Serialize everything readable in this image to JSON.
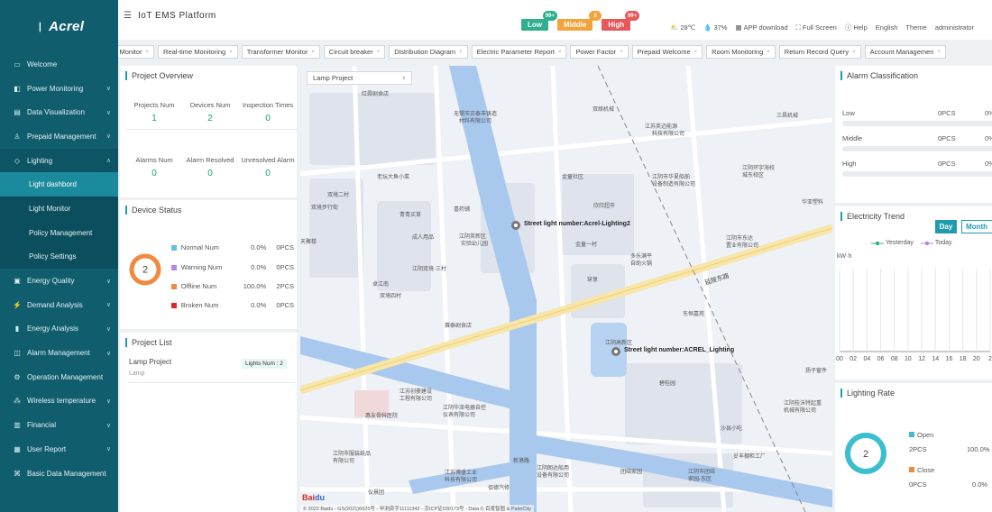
{
  "sidebar": {
    "logo_text": "Acrel",
    "items": [
      {
        "label": "Welcome",
        "icon": "monitor-icon",
        "chev": ""
      },
      {
        "label": "Power Monitoring",
        "icon": "power-icon",
        "chev": "∨"
      },
      {
        "label": "Data Visualization",
        "icon": "chart-screen-icon",
        "chev": "∨"
      },
      {
        "label": "Prepaid Management",
        "icon": "people-icon",
        "chev": "∨"
      },
      {
        "label": "Lighting",
        "icon": "diamond-icon",
        "chev": "∧"
      },
      {
        "label": "Light dashbord",
        "sub": true,
        "active": true
      },
      {
        "label": "Light Monitor",
        "sub": true
      },
      {
        "label": "Policy Management",
        "sub": true
      },
      {
        "label": "Policy Settings",
        "sub": true
      },
      {
        "label": "Energy Quality",
        "icon": "quality-icon",
        "chev": "∨"
      },
      {
        "label": "Demand Analysis",
        "icon": "demand-icon",
        "chev": "∨"
      },
      {
        "label": "Energy Analysis",
        "icon": "bar-chart-icon",
        "chev": "∨"
      },
      {
        "label": "Alarm Management",
        "icon": "alarm-icon",
        "chev": "∨"
      },
      {
        "label": "Operation Management",
        "icon": "operation-icon",
        "chev": ""
      },
      {
        "label": "Wireless temperature",
        "icon": "thermometer-icon",
        "chev": "∨"
      },
      {
        "label": "Financial",
        "icon": "financial-icon",
        "chev": "∨"
      },
      {
        "label": "User Report",
        "icon": "report-icon",
        "chev": "∨"
      },
      {
        "label": "Basic Data Management",
        "icon": "database-icon",
        "chev": ""
      }
    ]
  },
  "header": {
    "title": "IoT EMS Platform",
    "alarms": [
      {
        "label": "Low",
        "count": "99+",
        "color": "#2eb08f",
        "count_color": "#2eb08f"
      },
      {
        "label": "Middle",
        "count": "0",
        "color": "#f2a33a",
        "count_color": "#f2a33a"
      },
      {
        "label": "High",
        "count": "99+",
        "color": "#e8575a",
        "count_color": "#e8575a"
      }
    ],
    "temperature": "28℃",
    "humidity": "37%",
    "app_download": "APP download",
    "full_screen": "Full Screen",
    "help": "Help",
    "language": "English",
    "theme": "Theme",
    "user": "administrator"
  },
  "tabs": [
    "ic Monitor",
    "Real-time Monitoring",
    "Transformer Monitor",
    "Circuit breaker",
    "Distribution Diagram",
    "Electric Parameter Report",
    "Power Factor",
    "Prepaid Welcome",
    "Room Monitoring",
    "Return Record Query",
    "Account Managemen"
  ],
  "project_overview": {
    "title": "Project Overview",
    "stats": [
      {
        "label": "Projects Num",
        "value": "1"
      },
      {
        "label": "Devices Num",
        "value": "2"
      },
      {
        "label": "Inspection Times",
        "value": "0"
      },
      {
        "label": "Alarms Num",
        "value": "0"
      },
      {
        "label": "Alarm Resolved",
        "value": "0"
      },
      {
        "label": "Unresolved Alarm",
        "value": "0"
      }
    ]
  },
  "device_status": {
    "title": "Device Status",
    "center_value": "2",
    "rows": [
      {
        "label": "Normal Num",
        "percent": "0.0%",
        "count": "0PCS",
        "color": "#5fc3df"
      },
      {
        "label": "Warning Num",
        "percent": "0.0%",
        "count": "0PCS",
        "color": "#b785e8"
      },
      {
        "label": "Offline Num",
        "percent": "100.0%",
        "count": "2PCS",
        "color": "#f08a3e"
      },
      {
        "label": "Broken Num",
        "percent": "0.0%",
        "count": "0PCS",
        "color": "#e0262b"
      }
    ]
  },
  "project_list": {
    "title": "Project List",
    "project_name": "Lamp Project",
    "project_sub": "Lamp",
    "lights_num": "Lights Num : 2"
  },
  "map": {
    "select_value": "Lamp Project",
    "lamp_labels": [
      "Street light number:Acrel-Lighting2",
      "Street light number:ACREL_Lighting"
    ],
    "road_label": "延陵东路",
    "pois": [
      "红霞剧食店",
      "无锡市正泰丰铸造",
      "材料有限公司",
      "双络机械",
      "江苏英迈能源",
      "科技有限公司",
      "三昌机械",
      "老坛大鱼小菜",
      "双境二村",
      "双境步行街",
      "青青买草",
      "喜药铺",
      "欣欣超市",
      "金童社区",
      "江阴市华夏船舶",
      "设备制造有限公司",
      "江阴环宇海校",
      "城东校区",
      "华亚塑料",
      "天聚楼",
      "成人用品",
      "江阴英新区",
      "实验幼儿园",
      "金童一村",
      "穿享",
      "多乐满平",
      "自助火锅",
      "江阴市东达",
      "置业有限公司",
      "江阴双境·三村",
      "卓江南",
      "双境四村",
      "赛泰剧食店",
      "东恒嘉苑",
      "江阴高新区",
      "江苏创豪建设",
      "工程有限公司",
      "碧桂园",
      "江阴华泽电器自控",
      "仪表有限公司",
      "惠友骨科医院",
      "江阴桂沃特起重",
      "机械有限公司",
      "沙县小吃",
      "江阴市服装纸品",
      "有限公司",
      "新港路",
      "江苏博盛工业",
      "科技有限公司",
      "江阴朗达船用",
      "设备有限公司",
      "团结家园",
      "江阴市团结",
      "家园-东区",
      "妥丰棚柜工厂",
      "扬子窗件",
      "佰德汽修",
      "仪景团"
    ],
    "footer": "© 2022 Baidu - GS(2021)6026号 - 甲测资字11111342 - 京ICP证030173号 - Data © 百度智图 & PalmCity",
    "colors": {
      "land": "#eef1f6",
      "block": "#dfe4ec",
      "river": "#a8c8ee",
      "road_main": "#f7e6a8",
      "road": "#ffffff"
    }
  },
  "alarm_classification": {
    "title": "Alarm Classification",
    "rows": [
      {
        "label": "Low",
        "count": "0PCS",
        "percent": "0%"
      },
      {
        "label": "Middle",
        "count": "0PCS",
        "percent": "0%"
      },
      {
        "label": "High",
        "count": "0PCS",
        "percent": "0%"
      }
    ]
  },
  "electricity_trend": {
    "title": "Electricity Trend",
    "day_label": "Day",
    "month_label": "Month",
    "unit": "kW·h",
    "legend_yesterday": "Yesterday",
    "legend_today": "Today",
    "yesterday_color": "#2eb08f",
    "today_color": "#b785e8"
  },
  "lighting_rate": {
    "title": "Lighting Rate",
    "center_value": "2",
    "open_label": "Open",
    "open_count": "2PCS",
    "open_percent": "100.0%",
    "close_label": "Close",
    "close_count": "0PCS",
    "close_percent": "0.0%",
    "open_color": "#3bbfcf",
    "close_color": "#f08a3e"
  },
  "chart_data": {
    "type": "line",
    "title": "Electricity Trend",
    "ylabel": "kW·h",
    "x": [
      "00",
      "02",
      "04",
      "06",
      "08",
      "10",
      "12",
      "14",
      "16",
      "18",
      "20",
      "2"
    ],
    "series": [
      {
        "name": "Yesterday",
        "values": []
      },
      {
        "name": "Today",
        "values": []
      }
    ],
    "grid": true,
    "legend": "top"
  }
}
